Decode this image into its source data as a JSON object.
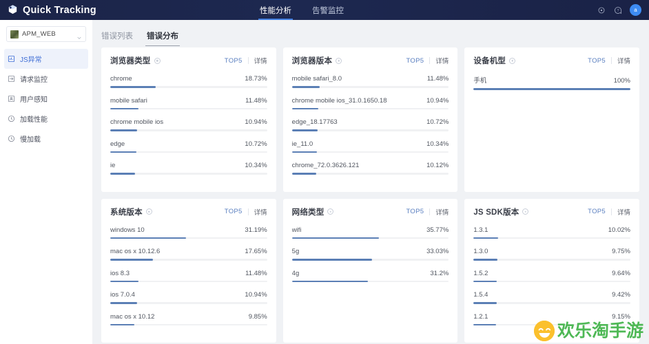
{
  "header": {
    "brand": "Quick Tracking",
    "brand_logo_icon": "cube-logo-icon",
    "nav_tabs": [
      {
        "label": "性能分析",
        "active": true
      },
      {
        "label": "告警监控",
        "active": false
      }
    ],
    "icons": [
      {
        "name": "settings-icon",
        "glyph": "⚙"
      },
      {
        "name": "help-icon",
        "glyph": "?"
      }
    ],
    "avatar_label": "a",
    "accent": "#3f7ddf"
  },
  "sidebar": {
    "project_name": "APM_WEB",
    "project_caret_icon": "chevron-down-icon",
    "items": [
      {
        "label": "JS异常",
        "icon": "chart-square-icon",
        "active": true
      },
      {
        "label": "请求监控",
        "icon": "request-square-icon",
        "active": false
      },
      {
        "label": "用户感知",
        "icon": "user-square-icon",
        "active": false
      },
      {
        "label": "加载性能",
        "icon": "clock-icon",
        "active": false
      },
      {
        "label": "慢加载",
        "icon": "slow-clock-icon",
        "active": false
      }
    ]
  },
  "main": {
    "tabs": [
      {
        "label": "错误列表",
        "active": false
      },
      {
        "label": "错误分布",
        "active": true
      }
    ],
    "card_actions": {
      "top5": "TOP5",
      "detail": "详情"
    },
    "bar_color": "#5b7fb5",
    "track_color": "#f0f1f3",
    "cards": [
      {
        "title": "浏览器类型",
        "rows": [
          {
            "label": "chrome",
            "value": "18.73%",
            "pct": 18.73
          },
          {
            "label": "mobile safari",
            "value": "11.48%",
            "pct": 11.48
          },
          {
            "label": "chrome mobile ios",
            "value": "10.94%",
            "pct": 10.94
          },
          {
            "label": "edge",
            "value": "10.72%",
            "pct": 10.72
          },
          {
            "label": "ie",
            "value": "10.34%",
            "pct": 10.34
          }
        ]
      },
      {
        "title": "浏览器版本",
        "rows": [
          {
            "label": "mobile safari_8.0",
            "value": "11.48%",
            "pct": 11.48
          },
          {
            "label": "chrome mobile ios_31.0.1650.18",
            "value": "10.94%",
            "pct": 10.94
          },
          {
            "label": "edge_18.17763",
            "value": "10.72%",
            "pct": 10.72
          },
          {
            "label": "ie_11.0",
            "value": "10.34%",
            "pct": 10.34
          },
          {
            "label": "chrome_72.0.3626.121",
            "value": "10.12%",
            "pct": 10.12
          }
        ]
      },
      {
        "title": "设备机型",
        "rows": [
          {
            "label": "手机",
            "value": "100%",
            "pct": 100
          }
        ]
      },
      {
        "title": "系统版本",
        "rows": [
          {
            "label": "windows 10",
            "value": "31.19%",
            "pct": 31.19
          },
          {
            "label": "mac os x 10.12.6",
            "value": "17.65%",
            "pct": 17.65
          },
          {
            "label": "ios 8.3",
            "value": "11.48%",
            "pct": 11.48
          },
          {
            "label": "ios 7.0.4",
            "value": "10.94%",
            "pct": 10.94
          },
          {
            "label": "mac os x 10.12",
            "value": "9.85%",
            "pct": 9.85
          }
        ]
      },
      {
        "title": "网络类型",
        "rows": [
          {
            "label": "wifi",
            "value": "35.77%",
            "pct": 35.77
          },
          {
            "label": "5g",
            "value": "33.03%",
            "pct": 33.03
          },
          {
            "label": "4g",
            "value": "31.2%",
            "pct": 31.2
          }
        ]
      },
      {
        "title": "JS SDK版本",
        "rows": [
          {
            "label": "1.3.1",
            "value": "10.02%",
            "pct": 10.02
          },
          {
            "label": "1.3.0",
            "value": "9.75%",
            "pct": 9.75
          },
          {
            "label": "1.5.2",
            "value": "9.64%",
            "pct": 9.64
          },
          {
            "label": "1.5.4",
            "value": "9.42%",
            "pct": 9.42
          },
          {
            "label": "1.2.1",
            "value": "9.15%",
            "pct": 9.15
          }
        ]
      }
    ]
  },
  "watermark": {
    "text": "欢乐淘手游"
  }
}
